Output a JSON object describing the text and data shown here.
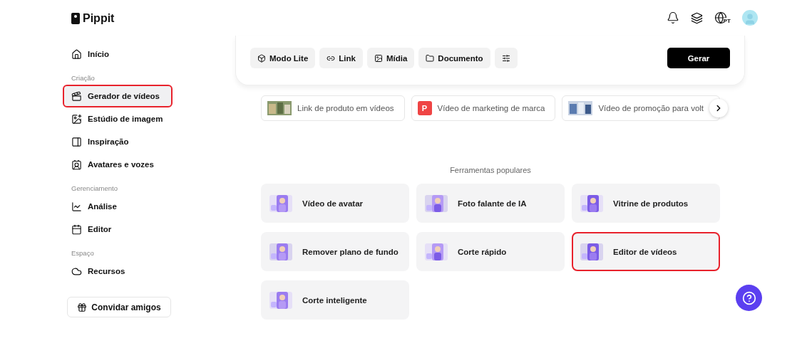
{
  "logo": {
    "text": "Pippit"
  },
  "sidebar": {
    "items": [
      {
        "kind": "item",
        "label": "Início",
        "selected": false,
        "highlighted": false
      },
      {
        "kind": "section",
        "label": "Criação"
      },
      {
        "kind": "item",
        "label": "Gerador de vídeos",
        "selected": true,
        "highlighted": true
      },
      {
        "kind": "item",
        "label": "Estúdio de imagem",
        "selected": false,
        "highlighted": false
      },
      {
        "kind": "item",
        "label": "Inspiração",
        "selected": false,
        "highlighted": false
      },
      {
        "kind": "item",
        "label": "Avatares e vozes",
        "selected": false,
        "highlighted": false
      },
      {
        "kind": "section",
        "label": "Gerenciamento"
      },
      {
        "kind": "item",
        "label": "Análise",
        "selected": false,
        "highlighted": false
      },
      {
        "kind": "item",
        "label": "Editor",
        "selected": false,
        "highlighted": false
      },
      {
        "kind": "section",
        "label": "Espaço"
      },
      {
        "kind": "item",
        "label": "Recursos",
        "selected": false,
        "highlighted": false
      }
    ],
    "invite_button": "Convidar amigos"
  },
  "header": {
    "language": "PT"
  },
  "composer": {
    "buttons": [
      "Modo Lite",
      "Link",
      "Mídia",
      "Documento"
    ],
    "generate_button": "Gerar"
  },
  "suggestions": [
    {
      "kind": "picture",
      "label": "Link de produto em vídeos"
    },
    {
      "kind": "letter",
      "letter": "P",
      "label": "Vídeo de marketing de marca"
    },
    {
      "kind": "picture",
      "label": "Vídeo de promoção para volt"
    }
  ],
  "popular_tools": {
    "title": "Ferramentas populares",
    "tools": [
      {
        "label": "Vídeo de avatar",
        "highlighted": false
      },
      {
        "label": "Foto falante de IA",
        "highlighted": false
      },
      {
        "label": "Vitrine de produtos",
        "highlighted": false
      },
      {
        "label": "Remover plano de fundo",
        "highlighted": false
      },
      {
        "label": "Corte rápido",
        "highlighted": false
      },
      {
        "label": "Editor de vídeos",
        "highlighted": true
      },
      {
        "label": "Corte inteligente",
        "highlighted": false
      }
    ]
  }
}
